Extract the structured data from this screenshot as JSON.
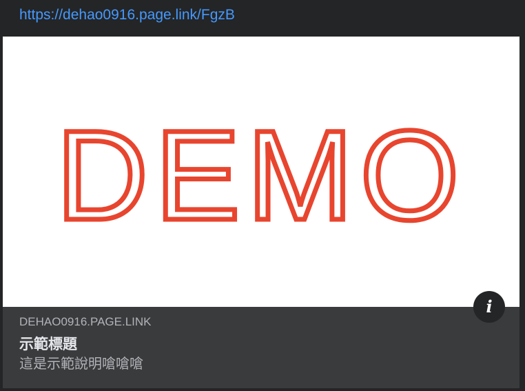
{
  "link": {
    "url": "https://dehao0916.page.link/FgzB"
  },
  "preview": {
    "image_text": "DEMO",
    "image_text_color": "#e8452f",
    "info_icon": "info-icon",
    "info_glyph": "i"
  },
  "card": {
    "domain": "DEHAO0916.PAGE.LINK",
    "title": "示範標題",
    "description": "這是示範說明嗆嗆嗆"
  },
  "colors": {
    "background": "#242526",
    "card_background": "#3a3b3c",
    "link": "#4599ff"
  }
}
